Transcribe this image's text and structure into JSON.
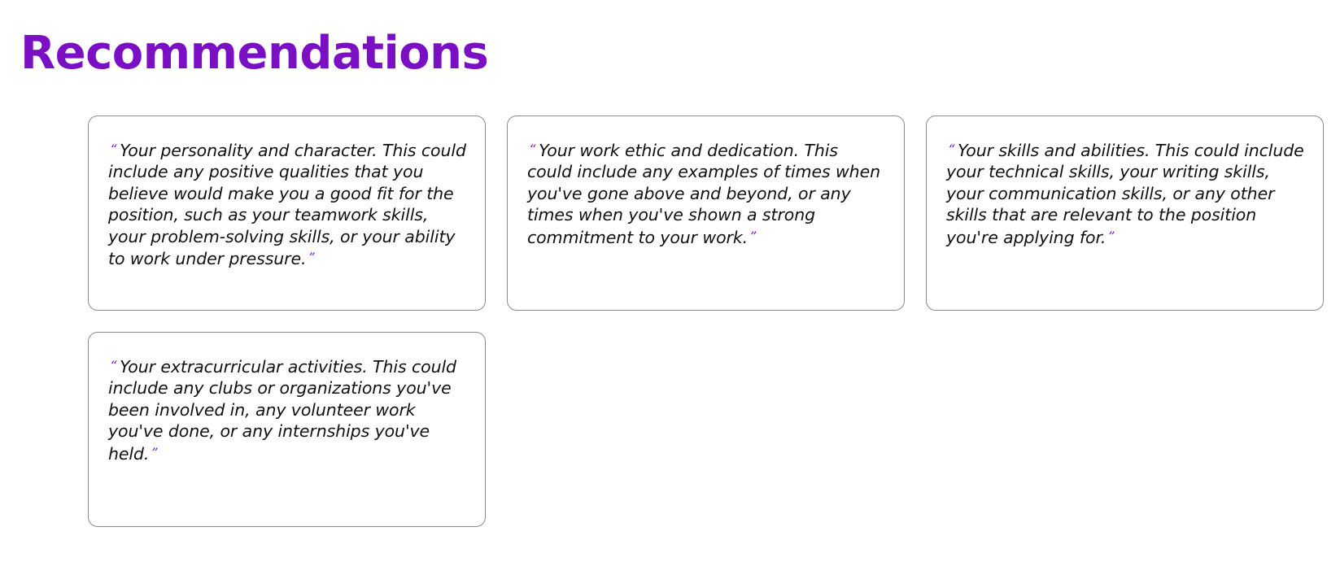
{
  "title": "Recommendations",
  "colors": {
    "accent": "#7b0fc4"
  },
  "quote_marks": {
    "open": "“",
    "close": "”"
  },
  "cards": [
    {
      "text": "Your personality and character. This could include any positive qualities that you believe would make you a good fit for the position, such as your teamwork skills, your problem-solving skills, or your ability to work under pressure."
    },
    {
      "text": "Your work ethic and dedication. This could include any examples of times when you've gone above and beyond, or any times when you've shown a strong commitment to your work."
    },
    {
      "text": "Your skills and abilities. This could include your technical skills, your writing skills, your communication skills, or any other skills that are relevant to the position you're applying for."
    },
    {
      "text": "Your extracurricular activities. This could include any clubs or organizations you've been involved in, any volunteer work you've done, or any internships you've held."
    }
  ]
}
